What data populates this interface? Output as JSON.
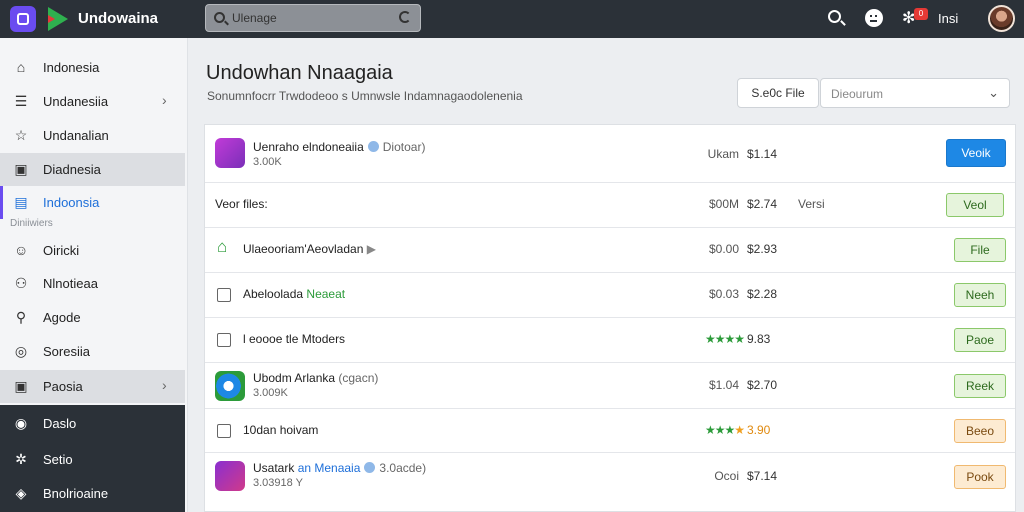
{
  "app": {
    "title": "Undowaina"
  },
  "search": {
    "placeholder": "Ulenage"
  },
  "topbar": {
    "badge": "0",
    "user_name": "Insi"
  },
  "sidebar": {
    "items": [
      {
        "label": "Indonesia",
        "icon": "home-icon"
      },
      {
        "label": "Undanesiia",
        "icon": "list-icon"
      },
      {
        "label": "Undanalian",
        "icon": "star-icon"
      },
      {
        "label": "Diadnesia",
        "icon": "image-icon"
      },
      {
        "label": "Indoonsia",
        "icon": "document-icon"
      }
    ],
    "section_label": "Diniiwiers",
    "items2": [
      {
        "label": "Oiricki",
        "icon": "person-icon"
      },
      {
        "label": "Nlnotieaa",
        "icon": "people-icon"
      },
      {
        "label": "Agode",
        "icon": "location-icon"
      },
      {
        "label": "Soresiia",
        "icon": "target-icon"
      },
      {
        "label": "Paosia",
        "icon": "folder-icon"
      }
    ],
    "dark_items": [
      {
        "label": "Daslo",
        "icon": "shield-icon"
      },
      {
        "label": "Setio",
        "icon": "gear-icon"
      },
      {
        "label": "Bnolrioaine",
        "icon": "puzzle-icon"
      }
    ]
  },
  "main": {
    "title": "Undowhan Nnaagaia",
    "subtitle": "Sonumnfocrr Trwdodeoo s Umnwsle Indamnagaodolenenia",
    "file_button": "S.e0c File",
    "select_value": "Dieourum"
  },
  "rows": [
    {
      "name": "Uenraho elndoneaiia",
      "paren": "Diotoar)",
      "sub": "3.00K",
      "meta": "Ukam",
      "price": "$1.14",
      "action": "Veoik"
    },
    {
      "name": "Veor files:",
      "meta": "$00M",
      "price": "$2.74",
      "extra": "Versi",
      "action": "Veol"
    },
    {
      "name": "Ulaeooriam'Aeovladan",
      "meta": "$0.00",
      "price": "$2.93",
      "action": "File"
    },
    {
      "name": "Abeloolada",
      "tag": "Neaeat",
      "meta": "$0.03",
      "price": "$2.28",
      "action": "Neeh"
    },
    {
      "name": "l eoooe tle Mtoders",
      "stars": 4,
      "price": "9.83",
      "action": "Paoe"
    },
    {
      "name": "Ubodm Arlanka",
      "paren": "(cgacn)",
      "sub": "3.009K",
      "meta": "$1.04",
      "price": "$2.70",
      "action": "Reek"
    },
    {
      "name": "10dan hoivam",
      "stars": 4,
      "price": "3.90",
      "action": "Beeo"
    },
    {
      "name": "Usatark",
      "name_link": "an Menaaia",
      "paren": "3.0acde)",
      "sub": "3.03918",
      "sub2": "Y",
      "meta": "Ocoi",
      "price": "$7.14",
      "action": "Pook"
    }
  ],
  "colors": {
    "accent": "#1e88e5",
    "topbar": "#2b3138",
    "brand": "#6a4cf0",
    "stars": "#2c9b3a"
  }
}
